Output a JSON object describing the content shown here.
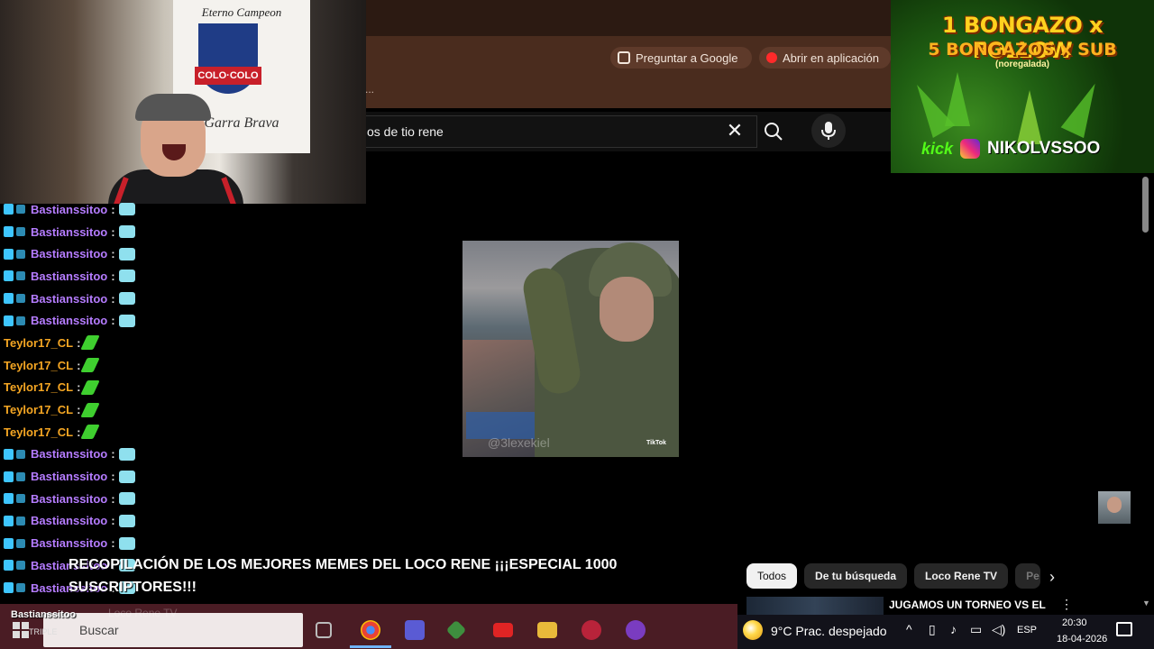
{
  "browser": {
    "ask_google_label": "Preguntar a Google",
    "open_app_label": "Abrir en aplicación",
    "more_label": "..."
  },
  "youtube": {
    "search_value": "os de tio rene",
    "video_title": "RECOPILACIÓN DE LOS MEJORES MEMES DEL LOCO RENE ¡¡¡ESPECIAL 1000 SUSCRIPTORES!!!",
    "chips": [
      "Todos",
      "De tu búsqueda",
      "Loco Rene TV",
      "Pe"
    ],
    "active_chip": "Todos",
    "next_video_title": "JUGAMOS UN TORNEO VS EL",
    "video_watermark": "@3lexekiel",
    "tiktok_label": "TikTok"
  },
  "cam": {
    "flag_top": "Eterno Campeon",
    "flag_badge": "COLO·COLO",
    "flag_bottom": "Garra Brava"
  },
  "promo": {
    "line1": "1 BONGAZO x FOLLOW",
    "line2": "5 BONGAZOS x SUB",
    "line3": "(noregalada)",
    "kick": "kick",
    "handle": "NIKOLVSSOO"
  },
  "chat": [
    {
      "user": "Bastianssitoo",
      "color": "purple",
      "emote": "cam"
    },
    {
      "user": "Bastianssitoo",
      "color": "purple",
      "emote": "cam"
    },
    {
      "user": "Bastianssitoo",
      "color": "purple",
      "emote": "cam"
    },
    {
      "user": "Bastianssitoo",
      "color": "purple",
      "emote": "cam"
    },
    {
      "user": "Bastianssitoo",
      "color": "purple",
      "emote": "cam"
    },
    {
      "user": "Bastianssitoo",
      "color": "purple",
      "emote": "cam"
    },
    {
      "user": "Teylor17_CL",
      "color": "orange",
      "emote": "leaf"
    },
    {
      "user": "Teylor17_CL",
      "color": "orange",
      "emote": "leaf"
    },
    {
      "user": "Teylor17_CL",
      "color": "orange",
      "emote": "leaf"
    },
    {
      "user": "Teylor17_CL",
      "color": "orange",
      "emote": "leaf"
    },
    {
      "user": "Teylor17_CL",
      "color": "orange",
      "emote": "leaf"
    },
    {
      "user": "Bastianssitoo",
      "color": "purple",
      "emote": "cam"
    },
    {
      "user": "Bastianssitoo",
      "color": "purple",
      "emote": "cam"
    },
    {
      "user": "Bastianssitoo",
      "color": "purple",
      "emote": "cam"
    },
    {
      "user": "Bastianssitoo",
      "color": "purple",
      "emote": "cam"
    },
    {
      "user": "Bastianssitoo",
      "color": "purple",
      "emote": "cam"
    },
    {
      "user": "Bastianssitoo",
      "color": "purple",
      "emote": "cam"
    },
    {
      "user": "Bastianssitoo",
      "color": "purple",
      "emote": "cam"
    }
  ],
  "chat_colon": ":",
  "taskbar": {
    "search_placeholder": "Buscar",
    "chat_overlay_user": "Bastianssitoo",
    "chat_overlay_sub": "TRIPLE",
    "ghost_text": "Loco Rene TV",
    "weather": "9°C  Prac. despejado",
    "lang": "ESP",
    "time": "20:30",
    "date": "18-04-2026"
  },
  "colors": {
    "chat_purple": "#b57cff",
    "chat_orange": "#f5a623",
    "yt_bg": "#000000",
    "taskbar_left": "#4a1c24"
  }
}
